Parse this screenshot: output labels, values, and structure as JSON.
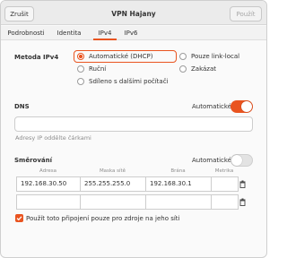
{
  "header": {
    "cancel_label": "Zrušit",
    "title": "VPN Hajany",
    "apply_label": "Použít"
  },
  "tabs": [
    {
      "label": "Podrobnosti"
    },
    {
      "label": "Identita"
    },
    {
      "label": "IPv4"
    },
    {
      "label": "IPv6"
    }
  ],
  "active_tab": "IPv4",
  "ipv4_method": {
    "label": "Metoda IPv4",
    "options": [
      {
        "label": "Automatické (DHCP)",
        "selected": true
      },
      {
        "label": "Pouze link-local",
        "selected": false
      },
      {
        "label": "Ruční",
        "selected": false
      },
      {
        "label": "Zakázat",
        "selected": false
      },
      {
        "label": "Sdíleno s dalšími počítači",
        "selected": false
      }
    ]
  },
  "dns": {
    "label": "DNS",
    "auto_label": "Automatické",
    "auto_enabled": true,
    "value": "",
    "hint": "Adresy IP oddělte čárkami"
  },
  "routes": {
    "label": "Směrování",
    "auto_label": "Automatické",
    "auto_enabled": false,
    "columns": [
      "Adresa",
      "Maska sítě",
      "Brána",
      "Metrika"
    ],
    "rows": [
      {
        "address": "192.168.30.50",
        "netmask": "255.255.255.0",
        "gateway": "192.168.30.1",
        "metric": ""
      },
      {
        "address": "",
        "netmask": "",
        "gateway": "",
        "metric": ""
      }
    ],
    "only_local_label": "Použít toto připojení pouze pro zdroje na jeho síti",
    "only_local_checked": true
  },
  "colors": {
    "accent": "#e95420",
    "header_bg": "#ebebeb"
  }
}
